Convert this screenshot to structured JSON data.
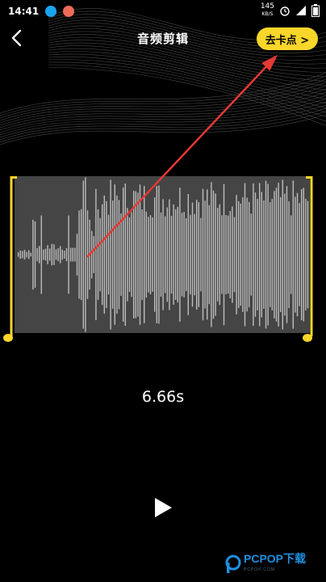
{
  "status_bar": {
    "time": "14:41",
    "net_speed": "145",
    "net_unit": "KB/S",
    "icons": [
      "qq-icon",
      "app-avatar-icon",
      "alarm-icon",
      "signal-icon",
      "battery-icon"
    ]
  },
  "header": {
    "title": "音频剪辑",
    "back_icon": "chevron-left-icon",
    "goto_button_label": "去卡点 >"
  },
  "waveform": {
    "handle_color": "#f9d62a",
    "panel_color": "#454545",
    "bar_color": "#bdbdbd"
  },
  "duration_text": "6.66s",
  "play_icon": "play-icon",
  "watermark": {
    "text": "PCPOP下载",
    "subtext": "PCPOP.COM"
  },
  "annotation": {
    "arrow_color": "#e53935"
  },
  "colors": {
    "accent": "#f9d62a",
    "background": "#000000"
  }
}
